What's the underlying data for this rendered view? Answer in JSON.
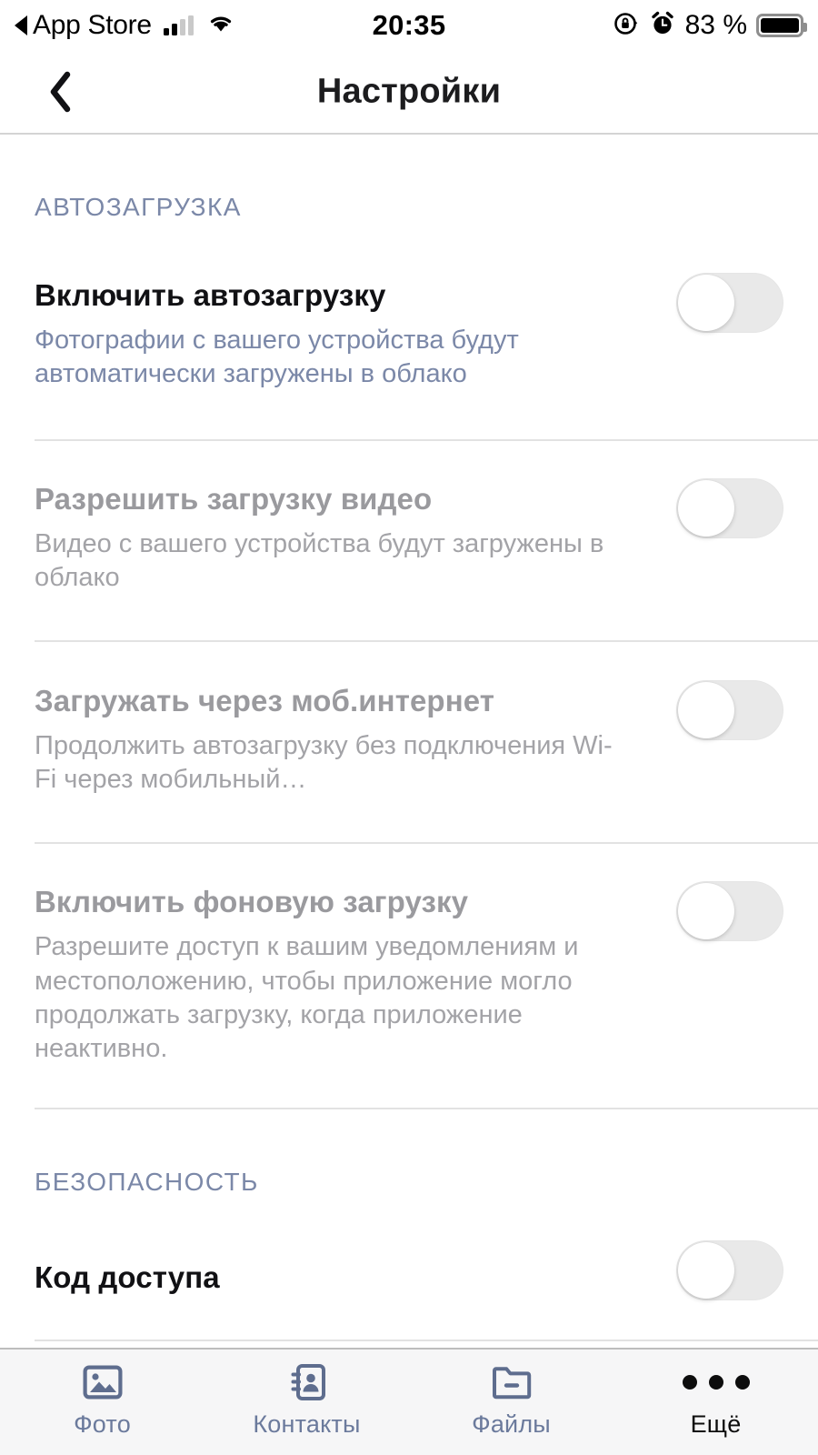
{
  "status_bar": {
    "back_label": "App Store",
    "back_icon": "triangle-left-icon",
    "signal_icon": "cellular-bars-icon",
    "wifi_icon": "wifi-icon",
    "time": "20:35",
    "rotation_lock_icon": "rotation-lock-icon",
    "alarm_icon": "alarm-clock-icon",
    "battery_percent": "83 %",
    "battery_icon": "battery-full-icon"
  },
  "header": {
    "back_icon": "chevron-left-icon",
    "title": "Настройки"
  },
  "sections": [
    {
      "title": "АВТОЗАГРУЗКА",
      "rows": [
        {
          "title": "Включить автозагрузку",
          "subtitle": "Фотографии с вашего устройства будут автоматически загружены в облако",
          "enabled": true,
          "toggle_on": false
        },
        {
          "title": "Разрешить загрузку видео",
          "subtitle": "Видео с вашего устройства будут загружены в облако",
          "enabled": false,
          "toggle_on": false
        },
        {
          "title": "Загружать через моб.интернет",
          "subtitle": "Продолжить автозагрузку без подключения Wi-Fi через мобильный…",
          "enabled": false,
          "toggle_on": false
        },
        {
          "title": "Включить фоновую загрузку",
          "subtitle": "Разрешите доступ к вашим уведомлениям и местоположению, чтобы приложение могло продолжать загрузку, когда приложение неактивно.",
          "enabled": false,
          "toggle_on": false
        }
      ]
    },
    {
      "title": "БЕЗОПАСНОСТЬ",
      "rows": [
        {
          "title": "Код доступа",
          "subtitle": "",
          "enabled": true,
          "toggle_on": false
        }
      ]
    }
  ],
  "tabbar": {
    "tabs": [
      {
        "label": "Фото",
        "icon": "photo-icon",
        "active": false
      },
      {
        "label": "Контакты",
        "icon": "contacts-icon",
        "active": false
      },
      {
        "label": "Файлы",
        "icon": "folder-icon",
        "active": false
      },
      {
        "label": "Ещё",
        "icon": "more-dots-icon",
        "active": true
      }
    ]
  },
  "colors": {
    "accent_slate": "#7b88a8",
    "title_active": "#111114",
    "title_disabled": "#9a9a9e",
    "toggle_track_off": "#e9e9e9",
    "tabbar_bg": "#f6f6f7"
  }
}
